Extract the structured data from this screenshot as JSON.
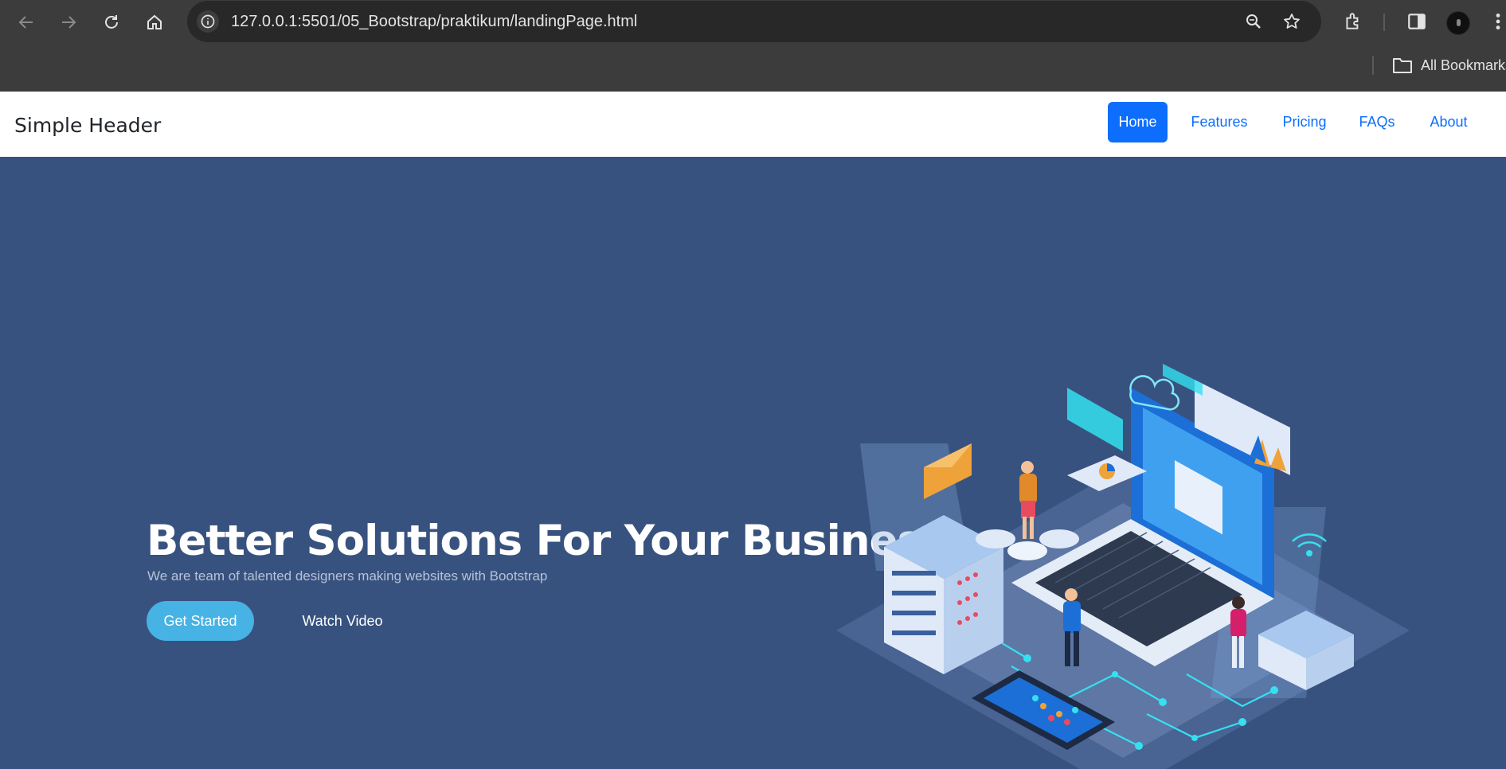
{
  "browser": {
    "url": "127.0.0.1:5501/05_Bootstrap/praktikum/landingPage.html",
    "bookmarks_label": "All Bookmarks",
    "icons": [
      "back-icon",
      "forward-icon",
      "reload-icon",
      "home-icon",
      "site-info-icon",
      "zoom-icon",
      "star-icon",
      "extensions-icon",
      "side-panel-icon",
      "profile-avatar",
      "menu-icon",
      "folder-icon"
    ]
  },
  "header": {
    "brand": "Simple Header",
    "nav": [
      {
        "label": "Home",
        "active": true
      },
      {
        "label": "Features",
        "active": false
      },
      {
        "label": "Pricing",
        "active": false
      },
      {
        "label": "FAQs",
        "active": false
      },
      {
        "label": "About",
        "active": false
      }
    ]
  },
  "hero": {
    "title": "Better Solutions For Your Business",
    "subtitle": "We are team of talented designers making websites with Bootstrap",
    "cta_primary": "Get Started",
    "cta_secondary": "Watch Video",
    "illustration": "isometric-tech-illustration"
  },
  "colors": {
    "hero_bg": "#38527f",
    "primary": "#0d6efd",
    "cta": "#47b2e4",
    "chrome_bg": "#3c3c3c",
    "omnibox_bg": "#282828"
  }
}
